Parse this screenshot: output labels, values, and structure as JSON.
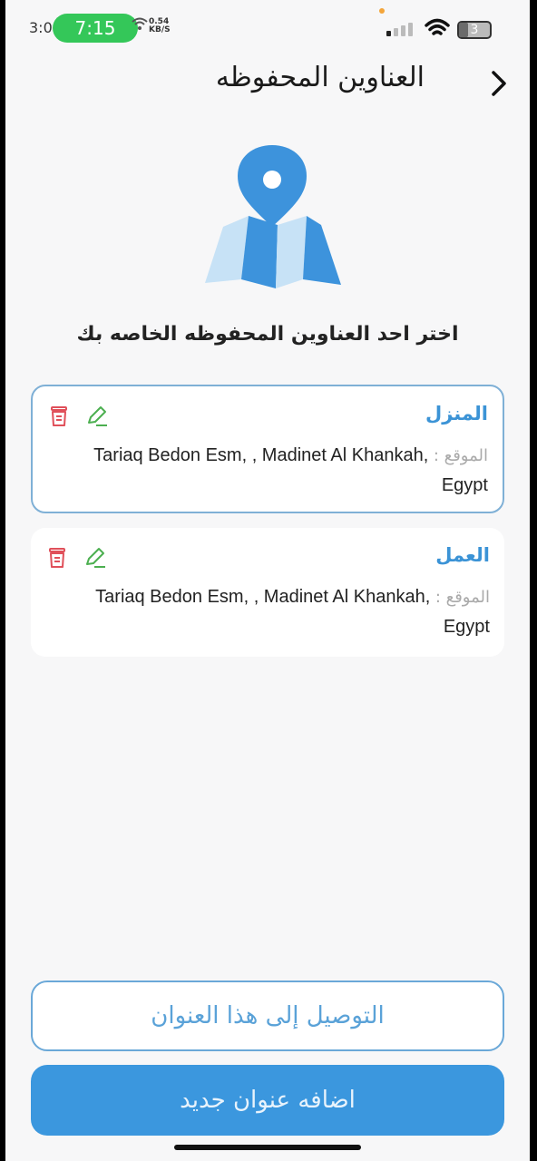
{
  "status_bar": {
    "clock_left": "3:0",
    "time": "7:15",
    "net_speed_value": "0.54",
    "net_speed_unit": "KB/S",
    "battery": "3"
  },
  "header": {
    "title": "العناوين المحفوظه"
  },
  "subtitle": "اختر احد العناوين المحفوظه الخاصه بك",
  "addresses": [
    {
      "name": "المنزل",
      "location_label": "الموقع :",
      "location": "Tariaq Bedon Esm, , Madinet Al Khankah, Egypt",
      "selected": true
    },
    {
      "name": "العمل",
      "location_label": "الموقع :",
      "location": "Tariaq Bedon Esm, , Madinet Al Khankah, Egypt",
      "selected": false
    }
  ],
  "buttons": {
    "deliver": "التوصيل إلى هذا العنوان",
    "add_new": "اضافه عنوان جديد"
  },
  "colors": {
    "accent": "#3b97de",
    "delete": "#e0505a",
    "edit": "#4caf50"
  }
}
